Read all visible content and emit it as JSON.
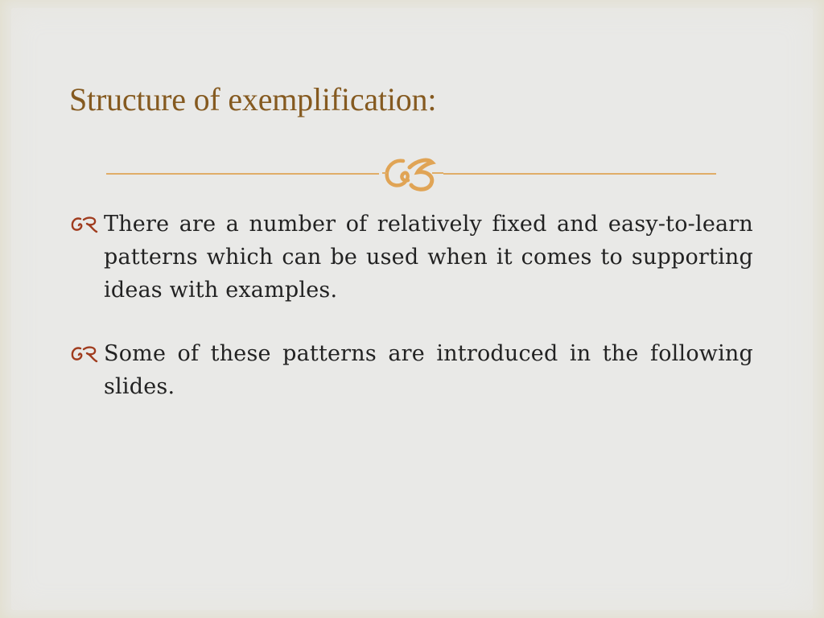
{
  "slide": {
    "title": "Structure of exemplification:",
    "divider_icon": "flourish-ornament-icon",
    "bullet_icon": "ornament-bullet-icon",
    "colors": {
      "title": "#855a20",
      "divider": "#e0ad68",
      "bullet_icon": "#a03c1e",
      "body_text": "#222222",
      "background": "#e9e9e7",
      "frame": "#e2dfcf"
    },
    "bullets": [
      {
        "text": "There are a number of relatively fixed and easy-to-learn patterns which can be used when it comes to supporting ideas with examples."
      },
      {
        "text": "Some of these patterns are introduced in the following slides."
      }
    ]
  }
}
